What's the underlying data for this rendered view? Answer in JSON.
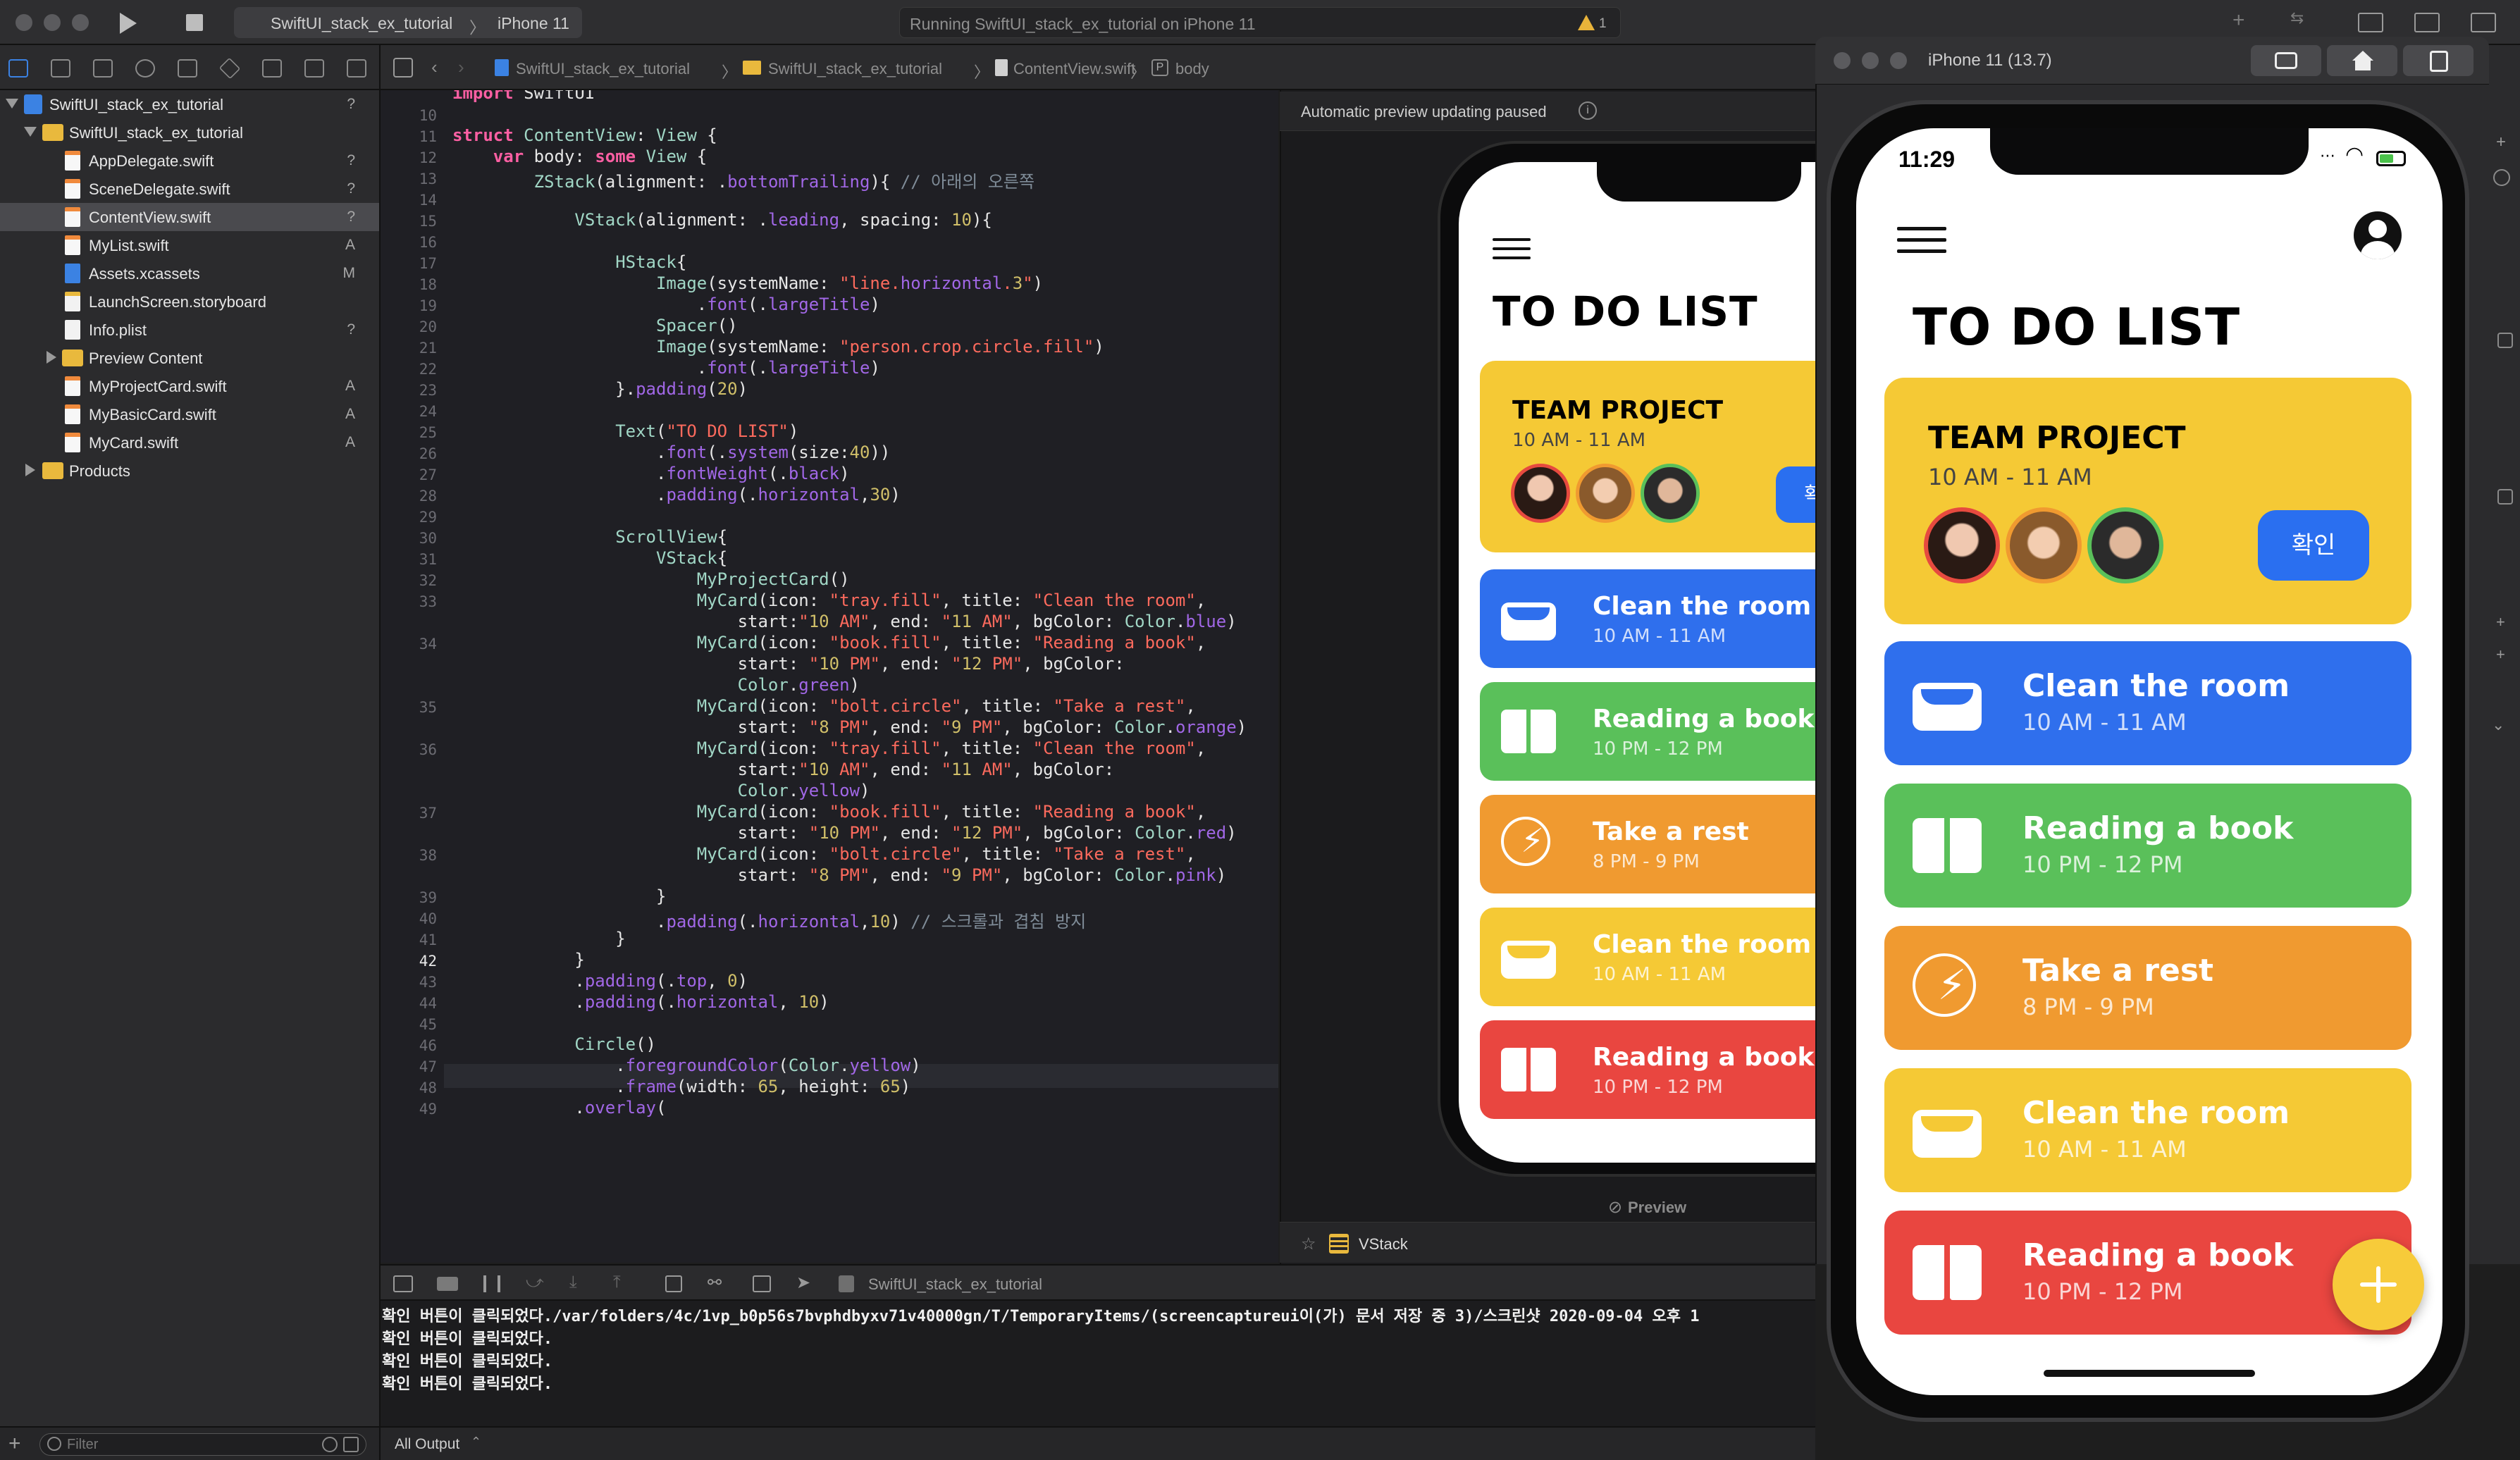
{
  "toolbar": {
    "scheme": "SwiftUI_stack_ex_tutorial",
    "device": "iPhone 11",
    "status": "Running SwiftUI_stack_ex_tutorial on iPhone 11",
    "warnings": "1"
  },
  "jump_bar": {
    "items": [
      "SwiftUI_stack_ex_tutorial",
      "SwiftUI_stack_ex_tutorial",
      "ContentView.swift",
      "body"
    ]
  },
  "navigator": {
    "items": [
      {
        "label": "SwiftUI_stack_ex_tutorial",
        "badge": "?",
        "kind": "project",
        "level": 0
      },
      {
        "label": "SwiftUI_stack_ex_tutorial",
        "badge": "",
        "kind": "folder",
        "level": 1
      },
      {
        "label": "AppDelegate.swift",
        "badge": "?",
        "kind": "swift",
        "level": 2
      },
      {
        "label": "SceneDelegate.swift",
        "badge": "?",
        "kind": "swift",
        "level": 2
      },
      {
        "label": "ContentView.swift",
        "badge": "?",
        "kind": "swift",
        "level": 2
      },
      {
        "label": "MyList.swift",
        "badge": "A",
        "kind": "swift",
        "level": 2
      },
      {
        "label": "Assets.xcassets",
        "badge": "M",
        "kind": "assets",
        "level": 2
      },
      {
        "label": "LaunchScreen.storyboard",
        "badge": "",
        "kind": "storyboard",
        "level": 2
      },
      {
        "label": "Info.plist",
        "badge": "?",
        "kind": "plist",
        "level": 2
      },
      {
        "label": "Preview Content",
        "badge": "",
        "kind": "folder",
        "level": 2
      },
      {
        "label": "MyProjectCard.swift",
        "badge": "A",
        "kind": "swift",
        "level": 2
      },
      {
        "label": "MyBasicCard.swift",
        "badge": "A",
        "kind": "swift",
        "level": 2
      },
      {
        "label": "MyCard.swift",
        "badge": "A",
        "kind": "swift",
        "level": 2
      },
      {
        "label": "Products",
        "badge": "",
        "kind": "folder",
        "level": 1
      }
    ],
    "filter_placeholder": "Filter"
  },
  "editor": {
    "current_line": "42",
    "lines": [
      {
        "n": "",
        "code": "import SwiftUI"
      },
      {
        "n": "10",
        "code": ""
      },
      {
        "n": "11",
        "code": "struct ContentView: View {"
      },
      {
        "n": "12",
        "code": "    var body: some View {"
      },
      {
        "n": "13",
        "code": "        ZStack(alignment: .bottomTrailing){ // 아래의 오른쪽"
      },
      {
        "n": "14",
        "code": ""
      },
      {
        "n": "15",
        "code": "            VStack(alignment: .leading, spacing: 10){"
      },
      {
        "n": "16",
        "code": ""
      },
      {
        "n": "17",
        "code": "                HStack{"
      },
      {
        "n": "18",
        "code": "                    Image(systemName: \"line.horizontal.3\")"
      },
      {
        "n": "19",
        "code": "                        .font(.largeTitle)"
      },
      {
        "n": "20",
        "code": "                    Spacer()"
      },
      {
        "n": "21",
        "code": "                    Image(systemName: \"person.crop.circle.fill\")"
      },
      {
        "n": "22",
        "code": "                        .font(.largeTitle)"
      },
      {
        "n": "23",
        "code": "                }.padding(20)"
      },
      {
        "n": "24",
        "code": ""
      },
      {
        "n": "25",
        "code": "                Text(\"TO DO LIST\")"
      },
      {
        "n": "26",
        "code": "                    .font(.system(size:40))"
      },
      {
        "n": "27",
        "code": "                    .fontWeight(.black)"
      },
      {
        "n": "28",
        "code": "                    .padding(.horizontal,30)"
      },
      {
        "n": "29",
        "code": ""
      },
      {
        "n": "30",
        "code": "                ScrollView{"
      },
      {
        "n": "31",
        "code": "                    VStack{"
      },
      {
        "n": "32",
        "code": "                        MyProjectCard()"
      },
      {
        "n": "33",
        "code": "                        MyCard(icon: \"tray.fill\", title: \"Clean the room\","
      },
      {
        "n": "",
        "code": "                            start:\"10 AM\", end: \"11 AM\", bgColor: Color.blue)"
      },
      {
        "n": "34",
        "code": "                        MyCard(icon: \"book.fill\", title: \"Reading a book\","
      },
      {
        "n": "",
        "code": "                            start: \"10 PM\", end: \"12 PM\", bgColor:"
      },
      {
        "n": "",
        "code": "                            Color.green)"
      },
      {
        "n": "35",
        "code": "                        MyCard(icon: \"bolt.circle\", title: \"Take a rest\","
      },
      {
        "n": "",
        "code": "                            start: \"8 PM\", end: \"9 PM\", bgColor: Color.orange)"
      },
      {
        "n": "36",
        "code": "                        MyCard(icon: \"tray.fill\", title: \"Clean the room\","
      },
      {
        "n": "",
        "code": "                            start:\"10 AM\", end: \"11 AM\", bgColor:"
      },
      {
        "n": "",
        "code": "                            Color.yellow)"
      },
      {
        "n": "37",
        "code": "                        MyCard(icon: \"book.fill\", title: \"Reading a book\","
      },
      {
        "n": "",
        "code": "                            start: \"10 PM\", end: \"12 PM\", bgColor: Color.red)"
      },
      {
        "n": "38",
        "code": "                        MyCard(icon: \"bolt.circle\", title: \"Take a rest\","
      },
      {
        "n": "",
        "code": "                            start: \"8 PM\", end: \"9 PM\", bgColor: Color.pink)"
      },
      {
        "n": "39",
        "code": "                    }"
      },
      {
        "n": "40",
        "code": "                    .padding(.horizontal,10) // 스크롤과 겹침 방지"
      },
      {
        "n": "41",
        "code": "                }"
      },
      {
        "n": "42",
        "code": "            }"
      },
      {
        "n": "43",
        "code": "            .padding(.top, 0)"
      },
      {
        "n": "44",
        "code": "            .padding(.horizontal, 10)"
      },
      {
        "n": "45",
        "code": ""
      },
      {
        "n": "46",
        "code": "            Circle()"
      },
      {
        "n": "47",
        "code": "                .foregroundColor(Color.yellow)"
      },
      {
        "n": "48",
        "code": "                .frame(width: 65, height: 65)"
      },
      {
        "n": "49",
        "code": "            .overlay("
      }
    ]
  },
  "debug": {
    "target": "SwiftUI_stack_ex_tutorial",
    "output_scope": "All Output",
    "filter_placeholder": "Filter",
    "console": [
      "확인 버튼이 클릭되었다./var/folders/4c/1vp_b0p56s7bvphdbyxv71v40000gn/T/TemporaryItems/(screencaptureui이(가) 문서 저장 중 3)/스크린샷 2020-09-04 오후 1",
      "확인 버튼이 클릭되었다.",
      "확인 버튼이 클릭되었다.",
      "확인 버튼이 클릭되었다."
    ]
  },
  "canvas": {
    "banner": "Automatic preview updating paused",
    "preview_label": "Preview",
    "selection": "VStack"
  },
  "simulator": {
    "title": "iPhone 11 (13.7)",
    "time": "11:29"
  },
  "app": {
    "title": "TO DO LIST",
    "project": {
      "title": "TEAM PROJECT",
      "time": "10 AM - 11 AM",
      "button": "확인"
    },
    "cards": [
      {
        "title": "Clean the room",
        "time": "10 AM - 11 AM",
        "icon": "tray-icon",
        "color": "#2f6fed"
      },
      {
        "title": "Reading a book",
        "time": "10 PM - 12 PM",
        "icon": "book-icon",
        "color": "#5ac05a"
      },
      {
        "title": "Take a rest",
        "time": "8 PM - 9 PM",
        "icon": "bolt-circle-icon",
        "color": "#f09a30"
      },
      {
        "title": "Clean the room",
        "time": "10 AM - 11 AM",
        "icon": "tray-icon",
        "color": "#f5c935"
      },
      {
        "title": "Reading a book",
        "time": "10 PM - 12 PM",
        "icon": "book-icon",
        "color": "#e94640"
      }
    ],
    "colors": {
      "project_bg": "#f5c935",
      "button": "#2a6ff0",
      "fab": "#f7cb3a"
    }
  }
}
